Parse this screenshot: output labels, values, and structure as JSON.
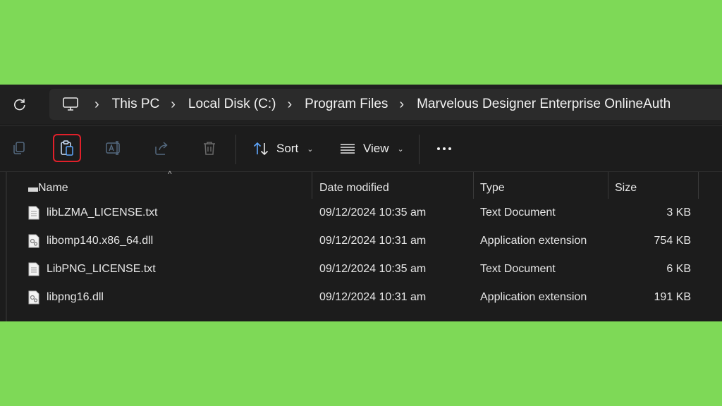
{
  "address_bar": {
    "crumbs": [
      "This PC",
      "Local Disk (C:)",
      "Program Files",
      "Marvelous Designer Enterprise OnlineAuth"
    ]
  },
  "toolbar": {
    "sort_label": "Sort",
    "view_label": "View"
  },
  "columns": {
    "name": "Name",
    "date": "Date modified",
    "type": "Type",
    "size": "Size"
  },
  "rows": [
    {
      "name": "libLZMA_LICENSE.txt",
      "date": "09/12/2024 10:35 am",
      "type": "Text Document",
      "size": "3 KB",
      "icon": "text-file-icon"
    },
    {
      "name": "libomp140.x86_64.dll",
      "date": "09/12/2024 10:31 am",
      "type": "Application extension",
      "size": "754 KB",
      "icon": "dll-file-icon"
    },
    {
      "name": "LibPNG_LICENSE.txt",
      "date": "09/12/2024 10:35 am",
      "type": "Text Document",
      "size": "6 KB",
      "icon": "text-file-icon"
    },
    {
      "name": "libpng16.dll",
      "date": "09/12/2024 10:31 am",
      "type": "Application extension",
      "size": "191 KB",
      "icon": "dll-file-icon"
    }
  ],
  "colors": {
    "background": "#7ed957",
    "window": "#1c1c1c",
    "highlight": "#e0202a"
  }
}
